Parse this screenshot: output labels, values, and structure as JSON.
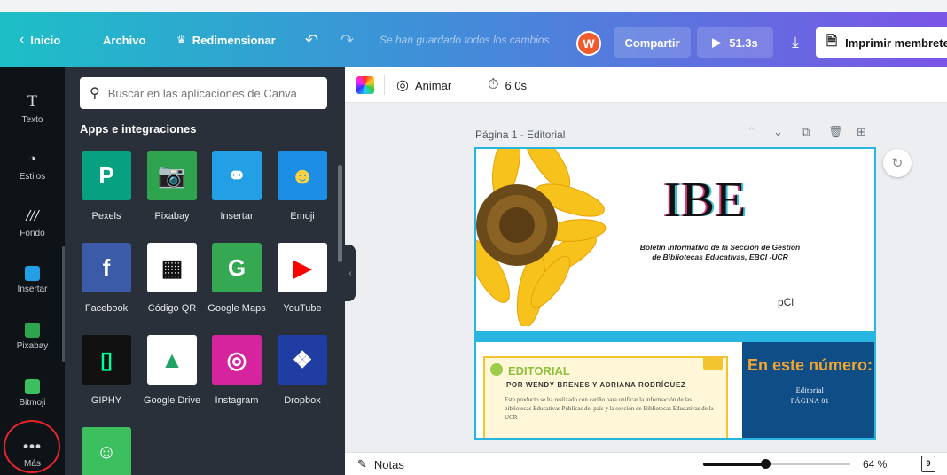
{
  "topbar": {
    "home": "Inicio",
    "file": "Archivo",
    "resize": "Redimensionar",
    "save_status": "Se han guardado todos los cambios",
    "avatar_initial": "W",
    "share": "Compartir",
    "play_time": "51.3s",
    "print": "Imprimir membretes"
  },
  "rail": {
    "text": "Texto",
    "styles": "Estilos",
    "background": "Fondo",
    "embed": "Insertar",
    "pixabay": "Pixabay",
    "bitmoji": "Bitmoji",
    "more": "Más"
  },
  "panel": {
    "search_placeholder": "Buscar en las aplicaciones de Canva",
    "section_title": "Apps e integraciones",
    "apps": [
      {
        "label": "Pexels",
        "icon": "pexels-icon",
        "color": "#07a081"
      },
      {
        "label": "Pixabay",
        "icon": "pixabay-icon",
        "color": "#2ea44f"
      },
      {
        "label": "Insertar",
        "icon": "embed-icon",
        "color": "#239fe6"
      },
      {
        "label": "Emoji",
        "icon": "emoji-icon",
        "color": "#1d8ee6"
      },
      {
        "label": "Facebook",
        "icon": "facebook-icon",
        "color": "#3b5ba8"
      },
      {
        "label": "Código QR",
        "icon": "qr-code-icon",
        "color": "#ffffff"
      },
      {
        "label": "Google Maps",
        "icon": "google-maps-icon",
        "color": "#34a853"
      },
      {
        "label": "YouTube",
        "icon": "youtube-icon",
        "color": "#ffffff"
      },
      {
        "label": "GIPHY",
        "icon": "giphy-icon",
        "color": "#111111"
      },
      {
        "label": "Google Drive",
        "icon": "google-drive-icon",
        "color": "#ffffff"
      },
      {
        "label": "Instagram",
        "icon": "instagram-icon",
        "color": "#d6249f"
      },
      {
        "label": "Dropbox",
        "icon": "dropbox-icon",
        "color": "#1f3da3"
      }
    ]
  },
  "canvas_toolbar": {
    "animate": "Animar",
    "duration": "6.0s"
  },
  "page": {
    "label": "Página 1 - Editorial",
    "doc_title": "IBE",
    "doc_subtitle_line1": "Boletín informativo de la Sección de Gestión",
    "doc_subtitle_line2": "de Bibliotecas Educativas, EBCI -UCR",
    "logo_text": "pCl",
    "editorial_title": "EDITORIAL",
    "editorial_author": "POR WENDY BRENES Y ADRIANA RODRÍGUEZ",
    "editorial_body": "Este producto se ha realizado con cariño para unificar la información de las bibliotecas Educativas Públicas del país y la sección de Bibliotecas Educativas de la UCR",
    "sidebar_heading": "En este número:",
    "sidebar_item": "Editorial",
    "sidebar_page": "PÁGINA 01"
  },
  "bottombar": {
    "notes": "Notas",
    "zoom_percent": "64 %",
    "zoom_fraction": 0.42,
    "page_count": "9"
  }
}
